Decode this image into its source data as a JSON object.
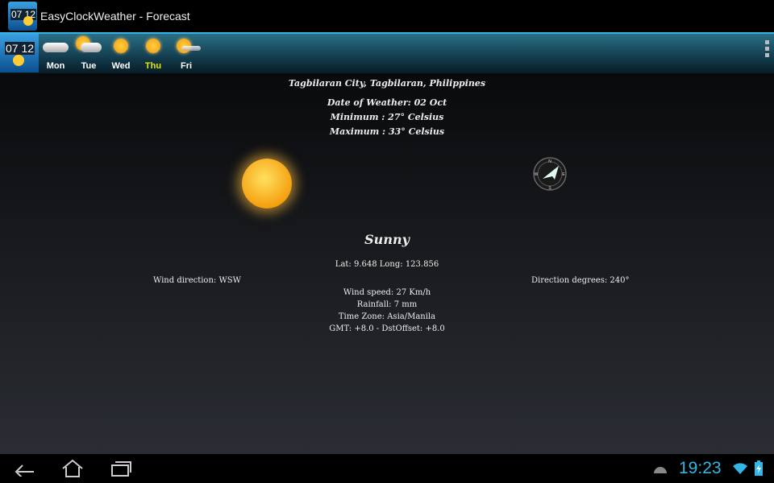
{
  "app": {
    "title": "EasyClockWeather - Forecast",
    "icon_time": "07 12"
  },
  "days": [
    {
      "label": "Mon",
      "icon": "cloudy",
      "selected": false
    },
    {
      "label": "Tue",
      "icon": "partly-cloudy",
      "selected": false
    },
    {
      "label": "Wed",
      "icon": "sunny",
      "selected": false
    },
    {
      "label": "Thu",
      "icon": "sunny",
      "selected": true
    },
    {
      "label": "Fri",
      "icon": "sunny-haze",
      "selected": false
    }
  ],
  "forecast": {
    "location": "Tagbilaran City, Tagbilaran, Philippines",
    "date": "Date of Weather: 02 Oct",
    "minimum": "Minimum : 27° Celsius",
    "maximum": "Maximum : 33° Celsius",
    "condition": "Sunny",
    "latlong": "Lat: 9.648 Long: 123.856",
    "wind_direction": "Wind direction: WSW",
    "direction_degrees": "Direction degrees: 240°",
    "wind_speed": "Wind speed: 27 Km/h",
    "rainfall": "Rainfall: 7 mm",
    "timezone": "Time Zone: Asia/Manila",
    "gmt": "GMT: +8.0 - DstOffset: +8.0"
  },
  "compass": {
    "n": "N",
    "e": "E",
    "s": "S",
    "w": "W",
    "degrees": 240
  },
  "status": {
    "clock": "19:23"
  },
  "colors": {
    "accent": "#33b5e5",
    "selected_day": "#e8e800"
  }
}
